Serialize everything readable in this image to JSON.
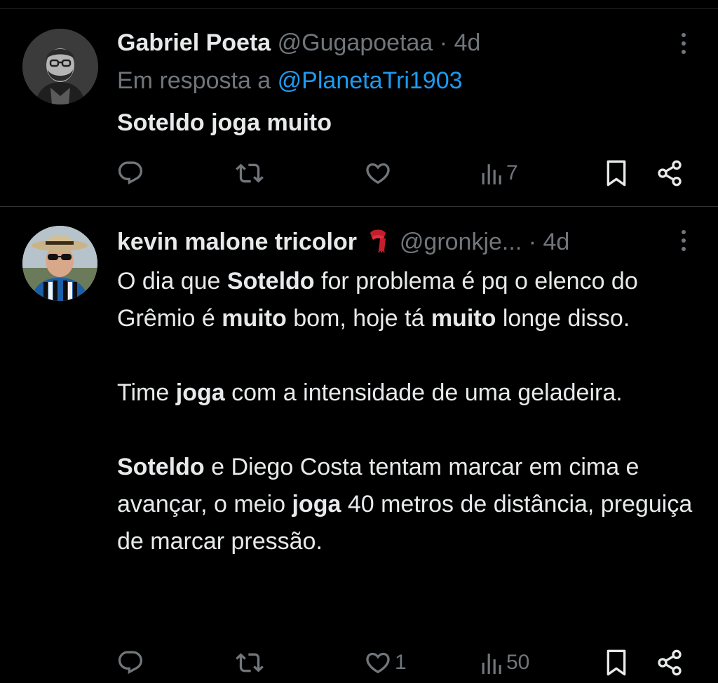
{
  "tweets": [
    {
      "name": "Gabriel Poeta",
      "handle": "@Gugapoetaa",
      "separator": "·",
      "time": "4d",
      "reply_prefix": "Em resposta a",
      "reply_mention": "@PlanetaTri1903",
      "text": "Soteldo joga muito",
      "metrics": {
        "replies": "",
        "retweets": "",
        "likes": "",
        "views": "7"
      }
    },
    {
      "name": "kevin malone tricolor",
      "emoji": "🧣",
      "handle": "@gronkje...",
      "separator": "·",
      "time": "4d",
      "text_segments": {
        "p1_a": "O dia que ",
        "p1_b": "Soteldo",
        "p1_c": " for problema é pq o elenco do Grêmio é ",
        "p1_d": "muito",
        "p1_e": " bom, hoje tá ",
        "p1_f": "muito",
        "p1_g": " longe disso.",
        "p2_a": "Time ",
        "p2_b": "joga",
        "p2_c": " com a intensidade de uma geladeira.",
        "p3_a": "Soteldo",
        "p3_b": " e Diego Costa tentam marcar em cima e avançar, o meio ",
        "p3_c": "joga",
        "p3_d": " 40 metros de distância, preguiça de marcar pressão."
      },
      "metrics": {
        "replies": "",
        "retweets": "",
        "likes": "1",
        "views": "50"
      }
    }
  ],
  "icons": {
    "reply": "reply-icon",
    "retweet": "retweet-icon",
    "like": "heart-icon",
    "views": "views-chart-icon",
    "bookmark": "bookmark-icon",
    "share": "share-icon",
    "more": "more-vertical-icon"
  },
  "colors": {
    "background": "#000000",
    "text": "#e7e9ea",
    "muted": "#71767b",
    "link": "#1d9bf0",
    "divider": "#2f3336"
  }
}
